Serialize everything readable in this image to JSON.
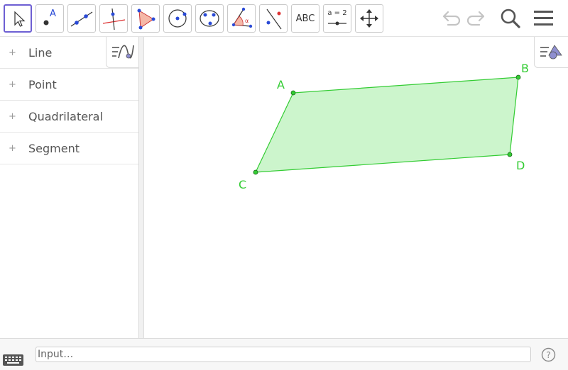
{
  "toolbar": {
    "tools": [
      {
        "id": "move",
        "icon": "arrow-pointer-icon"
      },
      {
        "id": "point",
        "icon": "point-icon",
        "label": "A"
      },
      {
        "id": "line",
        "icon": "line-icon"
      },
      {
        "id": "perpendicular",
        "icon": "perpendicular-line-icon"
      },
      {
        "id": "polygon",
        "icon": "polygon-icon"
      },
      {
        "id": "circle",
        "icon": "circle-center-icon"
      },
      {
        "id": "circle3",
        "icon": "circle-three-points-icon"
      },
      {
        "id": "angle",
        "icon": "angle-icon"
      },
      {
        "id": "reflect",
        "icon": "reflect-icon"
      },
      {
        "id": "text",
        "icon": "text-icon",
        "label": "ABC"
      },
      {
        "id": "slider",
        "icon": "slider-icon",
        "label": "a = 2"
      },
      {
        "id": "move-graphics",
        "icon": "move-graphics-icon"
      }
    ],
    "undo_icon": "undo-icon",
    "redo_icon": "redo-icon",
    "search_icon": "search-icon",
    "menu_icon": "menu-icon"
  },
  "algebra": {
    "items": [
      {
        "label": "Line"
      },
      {
        "label": "Point"
      },
      {
        "label": "Quadrilateral"
      },
      {
        "label": "Segment"
      }
    ],
    "style_icon": "algebra-style-icon"
  },
  "graphics": {
    "style_icon": "graphics-style-icon",
    "polygon_color": "#33cc33",
    "fill_color": "#ccf5cc",
    "points": [
      {
        "name": "A"
      },
      {
        "name": "B"
      },
      {
        "name": "C"
      },
      {
        "name": "D"
      }
    ]
  },
  "inputbar": {
    "placeholder": "Input…",
    "keyboard_icon": "keyboard-icon",
    "help_icon": "help-icon"
  }
}
